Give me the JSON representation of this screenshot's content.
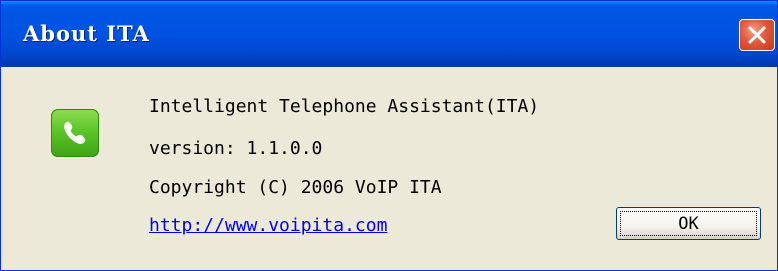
{
  "window": {
    "title": "About ITA"
  },
  "about": {
    "product_name": "Intelligent Telephone Assistant(ITA)",
    "version": "version: 1.1.0.0",
    "copyright": "Copyright (C) 2006 VoIP ITA",
    "website": "http://www.voipita.com"
  },
  "buttons": {
    "ok_label": "OK"
  },
  "icons": {
    "app_icon": "phone-handset-icon",
    "close_icon": "close-x-icon"
  },
  "colors": {
    "titlebar": "#0053e0",
    "close_button": "#e0573a",
    "dialog_background": "#ece9d8",
    "link": "#0000ee",
    "app_icon_green": "#5cc52a"
  }
}
